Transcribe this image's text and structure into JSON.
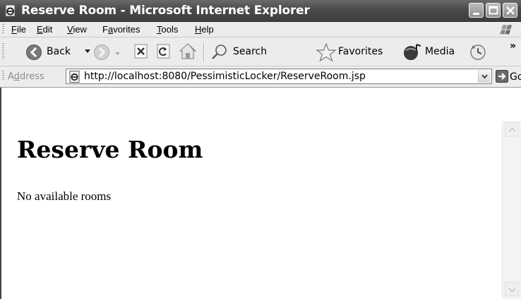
{
  "window": {
    "title": "Reserve Room - Microsoft Internet Explorer"
  },
  "menu": [
    {
      "accel": "F",
      "rest": "ile"
    },
    {
      "accel": "E",
      "rest": "dit"
    },
    {
      "accel": "V",
      "rest": "iew"
    },
    {
      "pre": "F",
      "accel": "a",
      "rest": "vorites"
    },
    {
      "accel": "T",
      "rest": "ools"
    },
    {
      "accel": "H",
      "rest": "elp"
    }
  ],
  "toolbar": {
    "back": "Back",
    "search": "Search",
    "favorites": "Favorites",
    "media": "Media",
    "overflow": "»"
  },
  "address": {
    "label_pre": "A",
    "label_accel": "d",
    "label_rest": "dress",
    "url": "http://localhost:8080/PessimisticLocker/ReserveRoom.jsp",
    "go": "Go"
  },
  "page": {
    "heading": "Reserve Room",
    "message": "No available rooms"
  }
}
